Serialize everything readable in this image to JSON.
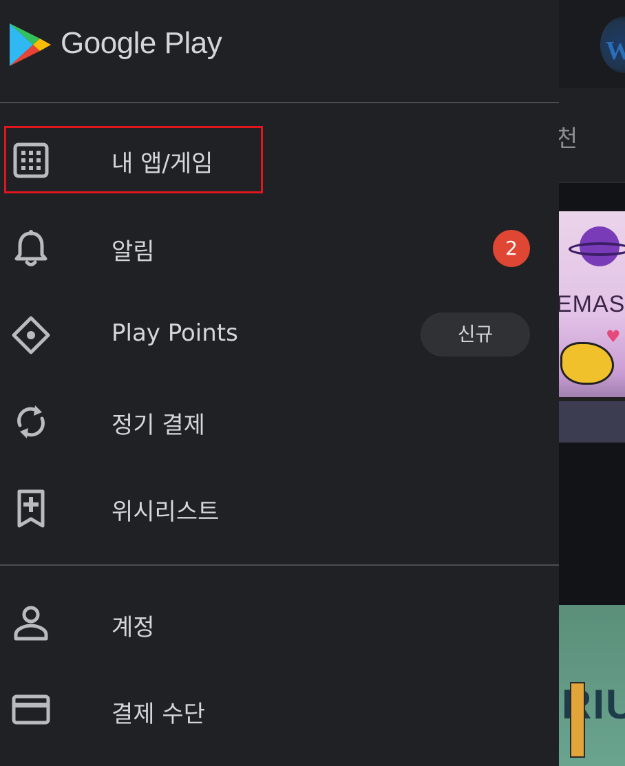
{
  "brand": {
    "name": "Google Play"
  },
  "menu": {
    "items": [
      {
        "id": "my-apps",
        "label": "내 앱/게임",
        "icon": "grid-icon"
      },
      {
        "id": "notifications",
        "label": "알림",
        "icon": "bell-icon",
        "badge": "2"
      },
      {
        "id": "play-points",
        "label": "Play Points",
        "icon": "diamond-icon",
        "tag": "신규"
      },
      {
        "id": "subscriptions",
        "label": "정기 결제",
        "icon": "refresh-icon"
      },
      {
        "id": "wishlist",
        "label": "위시리스트",
        "icon": "bookmark-add-icon"
      }
    ],
    "account_items": [
      {
        "id": "account",
        "label": "계정",
        "icon": "person-icon"
      },
      {
        "id": "payment",
        "label": "결제 수단",
        "icon": "credit-card-icon"
      }
    ]
  },
  "background": {
    "tab_text": "천",
    "card1_text": "EMAS",
    "card2_text": "RIU"
  },
  "colors": {
    "drawer_bg": "#202124",
    "text": "#d4d6d9",
    "badge": "#df4634",
    "highlight": "#e0161e",
    "pill_bg": "#303134"
  }
}
